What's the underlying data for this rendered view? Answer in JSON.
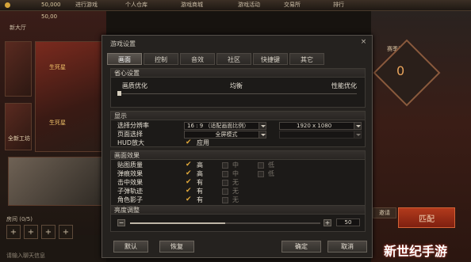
{
  "background": {
    "top_coin_value": "50,000",
    "top_coin_value_2": "50,00",
    "nav_items": [
      "进行游戏",
      "个人仓库",
      "游戏商城",
      "游戏活动",
      "交易所",
      "排行"
    ],
    "left_labels": [
      "生死星",
      "生死星",
      "全新工坊"
    ],
    "left_label_2": "新大厅",
    "rank_label": "赛季晋级",
    "rank_value": "0",
    "start_button": "匹配",
    "invite_button": "邀请",
    "room_label": "房间 (0/5)",
    "chat_placeholder": "请输入聊天信息",
    "watermark": "新世纪手游"
  },
  "dialog": {
    "title": "游戏设置",
    "close_label": "×",
    "tabs": [
      "画面",
      "控制",
      "音效",
      "社区",
      "快捷键",
      "其它"
    ],
    "active_tab": "画面",
    "preset": {
      "title": "省心设置",
      "left_label": "画质优化",
      "mid_label": "均衡",
      "right_label": "性能优化"
    },
    "display": {
      "title": "显示",
      "rows": [
        {
          "label": "选择分辨率",
          "value1": "16 : 9 （适配画面比例）",
          "value2": "1920 x 1080"
        },
        {
          "label": "页面选择",
          "value1": "全屏模式",
          "value2": ""
        },
        {
          "label": "HUD放大",
          "value1": "应用",
          "value2": ""
        }
      ]
    },
    "effects": {
      "title": "画面效果",
      "rows": [
        {
          "label": "贴图质量",
          "opt1": "高",
          "opt2": "中",
          "opt3": "低"
        },
        {
          "label": "弹痕效果",
          "opt1": "高",
          "opt2": "中",
          "opt3": "低"
        },
        {
          "label": "击中效果",
          "opt1": "有",
          "opt2": "无",
          "opt3": ""
        },
        {
          "label": "子弹轨迹",
          "opt1": "有",
          "opt2": "无",
          "opt3": ""
        },
        {
          "label": "角色影子",
          "opt1": "有",
          "opt2": "无",
          "opt3": ""
        }
      ]
    },
    "brightness": {
      "title": "亮度调整",
      "value": "50",
      "fraction": 0.5
    },
    "buttons": {
      "default": "默认",
      "restore": "恢复",
      "confirm": "确定",
      "cancel": "取消"
    }
  },
  "colors": {
    "check": "#e0a83a",
    "panel_bg": "#1c1a18",
    "accent_orange": "#b23a1c"
  }
}
